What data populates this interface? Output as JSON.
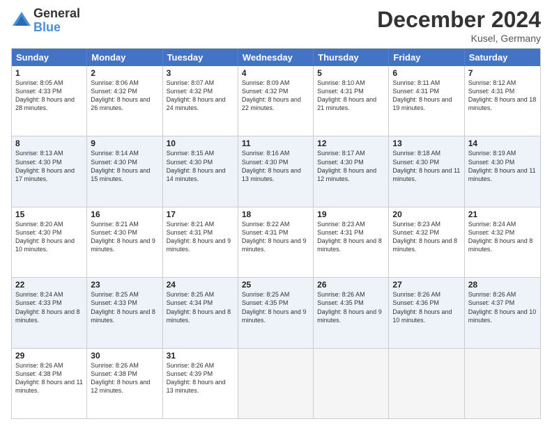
{
  "logo": {
    "general": "General",
    "blue": "Blue"
  },
  "title": "December 2024",
  "location": "Kusel, Germany",
  "days": [
    "Sunday",
    "Monday",
    "Tuesday",
    "Wednesday",
    "Thursday",
    "Friday",
    "Saturday"
  ],
  "weeks": [
    [
      {
        "day": "1",
        "sunrise": "8:05 AM",
        "sunset": "4:33 PM",
        "daylight": "8 hours and 28 minutes."
      },
      {
        "day": "2",
        "sunrise": "8:06 AM",
        "sunset": "4:32 PM",
        "daylight": "8 hours and 26 minutes."
      },
      {
        "day": "3",
        "sunrise": "8:07 AM",
        "sunset": "4:32 PM",
        "daylight": "8 hours and 24 minutes."
      },
      {
        "day": "4",
        "sunrise": "8:09 AM",
        "sunset": "4:32 PM",
        "daylight": "8 hours and 22 minutes."
      },
      {
        "day": "5",
        "sunrise": "8:10 AM",
        "sunset": "4:31 PM",
        "daylight": "8 hours and 21 minutes."
      },
      {
        "day": "6",
        "sunrise": "8:11 AM",
        "sunset": "4:31 PM",
        "daylight": "8 hours and 19 minutes."
      },
      {
        "day": "7",
        "sunrise": "8:12 AM",
        "sunset": "4:31 PM",
        "daylight": "8 hours and 18 minutes."
      }
    ],
    [
      {
        "day": "8",
        "sunrise": "8:13 AM",
        "sunset": "4:30 PM",
        "daylight": "8 hours and 17 minutes."
      },
      {
        "day": "9",
        "sunrise": "8:14 AM",
        "sunset": "4:30 PM",
        "daylight": "8 hours and 15 minutes."
      },
      {
        "day": "10",
        "sunrise": "8:15 AM",
        "sunset": "4:30 PM",
        "daylight": "8 hours and 14 minutes."
      },
      {
        "day": "11",
        "sunrise": "8:16 AM",
        "sunset": "4:30 PM",
        "daylight": "8 hours and 13 minutes."
      },
      {
        "day": "12",
        "sunrise": "8:17 AM",
        "sunset": "4:30 PM",
        "daylight": "8 hours and 12 minutes."
      },
      {
        "day": "13",
        "sunrise": "8:18 AM",
        "sunset": "4:30 PM",
        "daylight": "8 hours and 11 minutes."
      },
      {
        "day": "14",
        "sunrise": "8:19 AM",
        "sunset": "4:30 PM",
        "daylight": "8 hours and 11 minutes."
      }
    ],
    [
      {
        "day": "15",
        "sunrise": "8:20 AM",
        "sunset": "4:30 PM",
        "daylight": "8 hours and 10 minutes."
      },
      {
        "day": "16",
        "sunrise": "8:21 AM",
        "sunset": "4:30 PM",
        "daylight": "8 hours and 9 minutes."
      },
      {
        "day": "17",
        "sunrise": "8:21 AM",
        "sunset": "4:31 PM",
        "daylight": "8 hours and 9 minutes."
      },
      {
        "day": "18",
        "sunrise": "8:22 AM",
        "sunset": "4:31 PM",
        "daylight": "8 hours and 9 minutes."
      },
      {
        "day": "19",
        "sunrise": "8:23 AM",
        "sunset": "4:31 PM",
        "daylight": "8 hours and 8 minutes."
      },
      {
        "day": "20",
        "sunrise": "8:23 AM",
        "sunset": "4:32 PM",
        "daylight": "8 hours and 8 minutes."
      },
      {
        "day": "21",
        "sunrise": "8:24 AM",
        "sunset": "4:32 PM",
        "daylight": "8 hours and 8 minutes."
      }
    ],
    [
      {
        "day": "22",
        "sunrise": "8:24 AM",
        "sunset": "4:33 PM",
        "daylight": "8 hours and 8 minutes."
      },
      {
        "day": "23",
        "sunrise": "8:25 AM",
        "sunset": "4:33 PM",
        "daylight": "8 hours and 8 minutes."
      },
      {
        "day": "24",
        "sunrise": "8:25 AM",
        "sunset": "4:34 PM",
        "daylight": "8 hours and 8 minutes."
      },
      {
        "day": "25",
        "sunrise": "8:25 AM",
        "sunset": "4:35 PM",
        "daylight": "8 hours and 9 minutes."
      },
      {
        "day": "26",
        "sunrise": "8:26 AM",
        "sunset": "4:35 PM",
        "daylight": "8 hours and 9 minutes."
      },
      {
        "day": "27",
        "sunrise": "8:26 AM",
        "sunset": "4:36 PM",
        "daylight": "8 hours and 10 minutes."
      },
      {
        "day": "28",
        "sunrise": "8:26 AM",
        "sunset": "4:37 PM",
        "daylight": "8 hours and 10 minutes."
      }
    ],
    [
      {
        "day": "29",
        "sunrise": "8:26 AM",
        "sunset": "4:38 PM",
        "daylight": "8 hours and 11 minutes."
      },
      {
        "day": "30",
        "sunrise": "8:26 AM",
        "sunset": "4:38 PM",
        "daylight": "8 hours and 12 minutes."
      },
      {
        "day": "31",
        "sunrise": "8:26 AM",
        "sunset": "4:39 PM",
        "daylight": "8 hours and 13 minutes."
      },
      null,
      null,
      null,
      null
    ]
  ]
}
